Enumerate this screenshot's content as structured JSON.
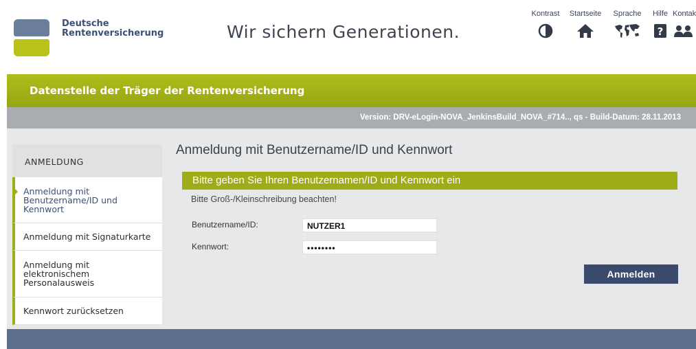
{
  "header": {
    "brand_line1": "Deutsche",
    "brand_line2": "Rentenversicherung",
    "slogan": "Wir sichern Generationen.",
    "nav": [
      {
        "label": "Kontrast",
        "icon": "contrast-icon"
      },
      {
        "label": "Startseite",
        "icon": "home-icon"
      },
      {
        "label": "Sprache",
        "icon": "world-map-icon"
      },
      {
        "label": "Hilfe",
        "icon": "help-icon"
      },
      {
        "label": "Kontak",
        "icon": "contact-people-icon"
      }
    ]
  },
  "banner": {
    "title": "Datenstelle der Träger der Rentenversicherung",
    "version": "Version: DRV-eLogin-NOVA_JenkinsBuild_NOVA_#714.., qs - Build-Datum: 28.11.2013"
  },
  "sidebar": {
    "heading": "ANMELDUNG",
    "items": [
      {
        "label": "Anmeldung mit Benutzername/ID und Kennwort",
        "lines": [
          "Anmeldung mit",
          "Benutzername/ID und",
          "Kennwort"
        ]
      },
      {
        "label": "Anmeldung mit Signaturkarte"
      },
      {
        "label": "Anmeldung mit elektronischem Personalausweis",
        "lines": [
          "Anmeldung mit",
          "elektronischem",
          "Personalausweis"
        ]
      },
      {
        "label": "Kennwort zurücksetzen"
      }
    ]
  },
  "main": {
    "title": "Anmeldung mit Benutzername/ID und Kennwort",
    "subtitle": "Bitte geben Sie Ihren Benutzernamen/ID und Kennwort ein",
    "hint": "Bitte Groß-/Kleinschreibung beachten!",
    "username_label": "Benutzername/ID:",
    "username_value": "NUTZER1",
    "password_label": "Kennwort:",
    "password_value": "••••••••",
    "submit_label": "Anmelden"
  },
  "colors": {
    "accent_green": "#9dac18",
    "navy": "#3a4a6c",
    "footer": "#5d6e8e"
  }
}
